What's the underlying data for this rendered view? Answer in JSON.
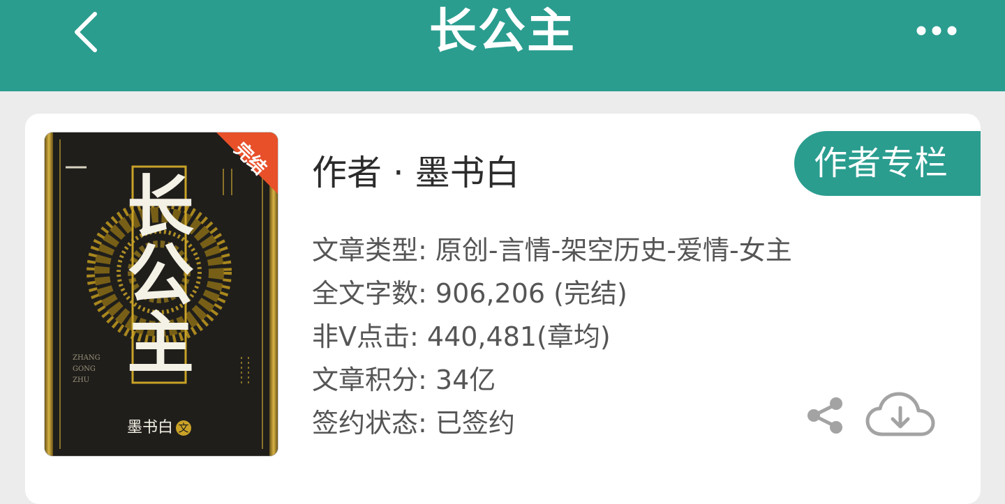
{
  "header": {
    "title": "长公主",
    "back_icon": "chevron-left-icon",
    "more_icon": "more-horizontal-icon"
  },
  "book": {
    "cover": {
      "title": "长公主",
      "badge": "完结",
      "author": "墨书白",
      "author_mark": "文",
      "pinyin_1": "ZHANG",
      "pinyin_2": "GONG",
      "pinyin_3": "ZHU"
    },
    "author_line": "作者 · 墨书白",
    "column_button": "作者专栏",
    "info": [
      {
        "label": "文章类型:",
        "value": "原创-言情-架空历史-爱情-女主"
      },
      {
        "label": "全文字数:",
        "value": "906,206 (完结)"
      },
      {
        "label": "非V点击:",
        "value": "440,481(章均)"
      },
      {
        "label": "文章积分:",
        "value": "34亿"
      },
      {
        "label": "签约状态:",
        "value": "已签约"
      }
    ]
  },
  "actions": {
    "share_icon": "share-icon",
    "download_icon": "cloud-download-icon"
  },
  "colors": {
    "accent": "#2a9d8f",
    "badge": "#e8502a",
    "cover_gold": "#c9a227"
  }
}
